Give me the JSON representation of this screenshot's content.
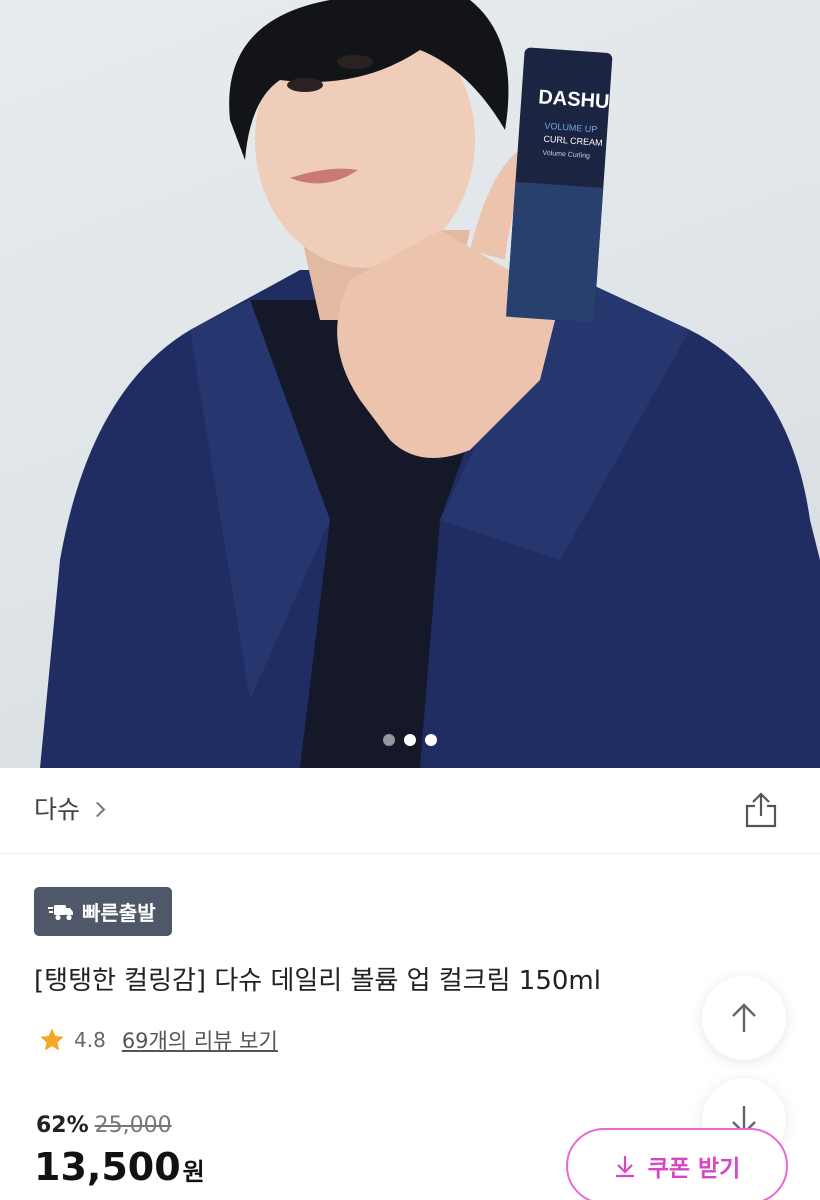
{
  "hero": {
    "product_brand": "DASHU",
    "product_line1": "VOLUME UP",
    "product_line2": "CURL CREAM",
    "product_sub": "Volume Curling",
    "carousel_total": 3,
    "carousel_active": 2
  },
  "brand": {
    "name": "다슈"
  },
  "badge": {
    "label": "빠른출발"
  },
  "product": {
    "title": "[탱탱한 컬링감] 다슈 데일리 볼륨 업 컬크림 150ml",
    "rating": "4.8",
    "review_link": "69개의 리뷰 보기"
  },
  "pricing": {
    "discount": "62%",
    "original_price": "25,000",
    "price": "13,500",
    "currency": "원"
  },
  "coupon": {
    "label": "쿠폰 받기"
  },
  "colors": {
    "badge_bg": "#4e5868",
    "star": "#f5a623",
    "coupon_accent": "#d846c2",
    "jacket": "#1f2d63"
  },
  "icons": [
    "chevron-right-icon",
    "share-icon",
    "truck-icon",
    "star-icon",
    "arrow-up-icon",
    "arrow-down-icon",
    "download-icon"
  ]
}
